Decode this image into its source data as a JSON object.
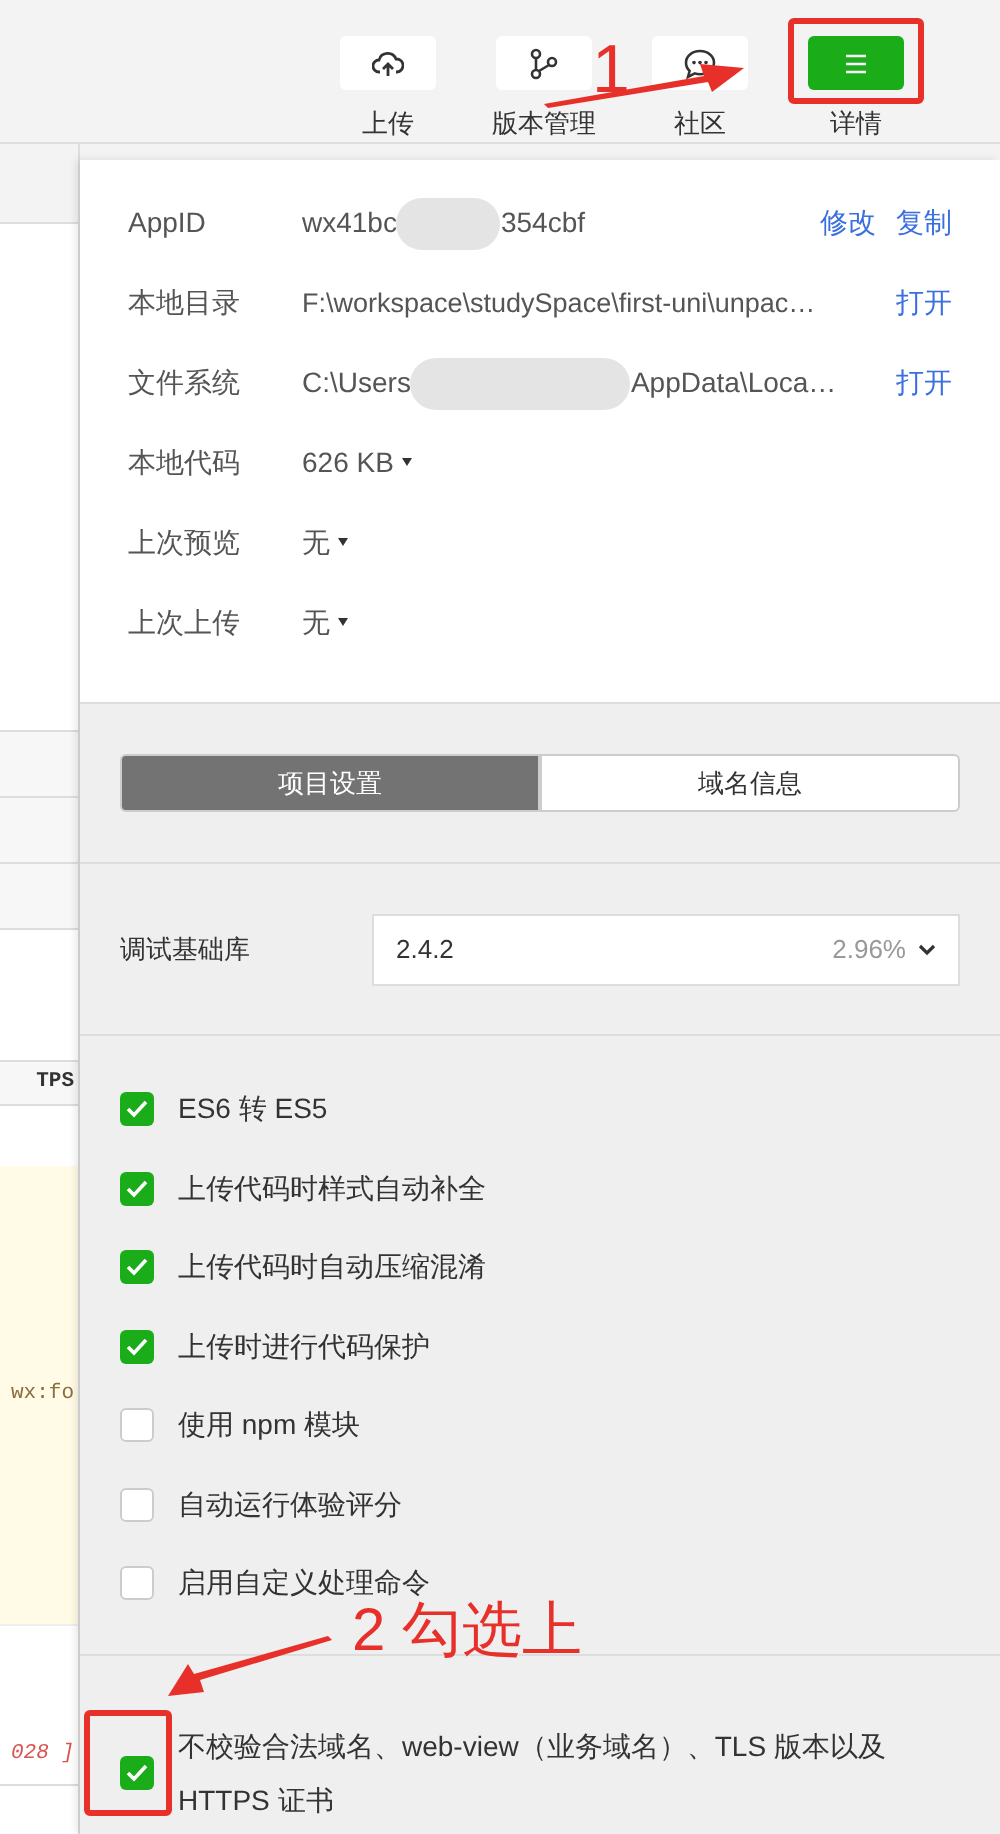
{
  "toolbar": {
    "buttons": [
      {
        "label": "上传",
        "kind": "upload",
        "selected": false
      },
      {
        "label": "版本管理",
        "kind": "branch",
        "selected": false
      },
      {
        "label": "社区",
        "kind": "chat",
        "selected": false
      },
      {
        "label": "详情",
        "kind": "menu",
        "selected": true
      }
    ]
  },
  "editor_fragments": [
    {
      "text": "TPS",
      "kind": "header"
    },
    {
      "text": "wx:fo",
      "kind": "code"
    },
    {
      "text": "028 ]",
      "kind": "error"
    }
  ],
  "details": {
    "rows": [
      {
        "label": "AppID",
        "kind": "redacted",
        "value_start": "wx41bc",
        "value_end": "354cbf",
        "actions": [
          "修改",
          "复制"
        ]
      },
      {
        "label": "本地目录",
        "kind": "text",
        "value": "F:\\workspace\\studySpace\\first-uni\\unpac…",
        "actions": [
          "打开"
        ]
      },
      {
        "label": "文件系统",
        "kind": "redacted",
        "value_start": "C:\\Users",
        "value_end": "AppData\\Loca…",
        "actions": [
          "打开"
        ]
      },
      {
        "label": "本地代码",
        "kind": "dropdown",
        "value": "626 KB"
      },
      {
        "label": "上次预览",
        "kind": "dropdown",
        "value": "无"
      },
      {
        "label": "上次上传",
        "kind": "dropdown",
        "value": "无"
      }
    ]
  },
  "tabs": [
    {
      "label": "项目设置",
      "selected": true
    },
    {
      "label": "域名信息",
      "selected": false
    }
  ],
  "library": {
    "label": "调试基础库",
    "version": "2.4.2",
    "share": "2.96%"
  },
  "options": [
    {
      "label": "ES6 转 ES5",
      "checked": true
    },
    {
      "label": "上传代码时样式自动补全",
      "checked": true
    },
    {
      "label": "上传代码时自动压缩混淆",
      "checked": true
    },
    {
      "label": "上传时进行代码保护",
      "checked": true
    },
    {
      "label": "使用 npm 模块",
      "checked": false
    },
    {
      "label": "自动运行体验评分",
      "checked": false
    },
    {
      "label": "启用自定义处理命令",
      "checked": false
    }
  ],
  "last_option": {
    "label": "不校验合法域名、web-view（业务域名）、TLS 版本以及 HTTPS 证书",
    "checked": true
  },
  "annotations": [
    {
      "text": "1"
    },
    {
      "text": "2 勾选上"
    }
  ]
}
